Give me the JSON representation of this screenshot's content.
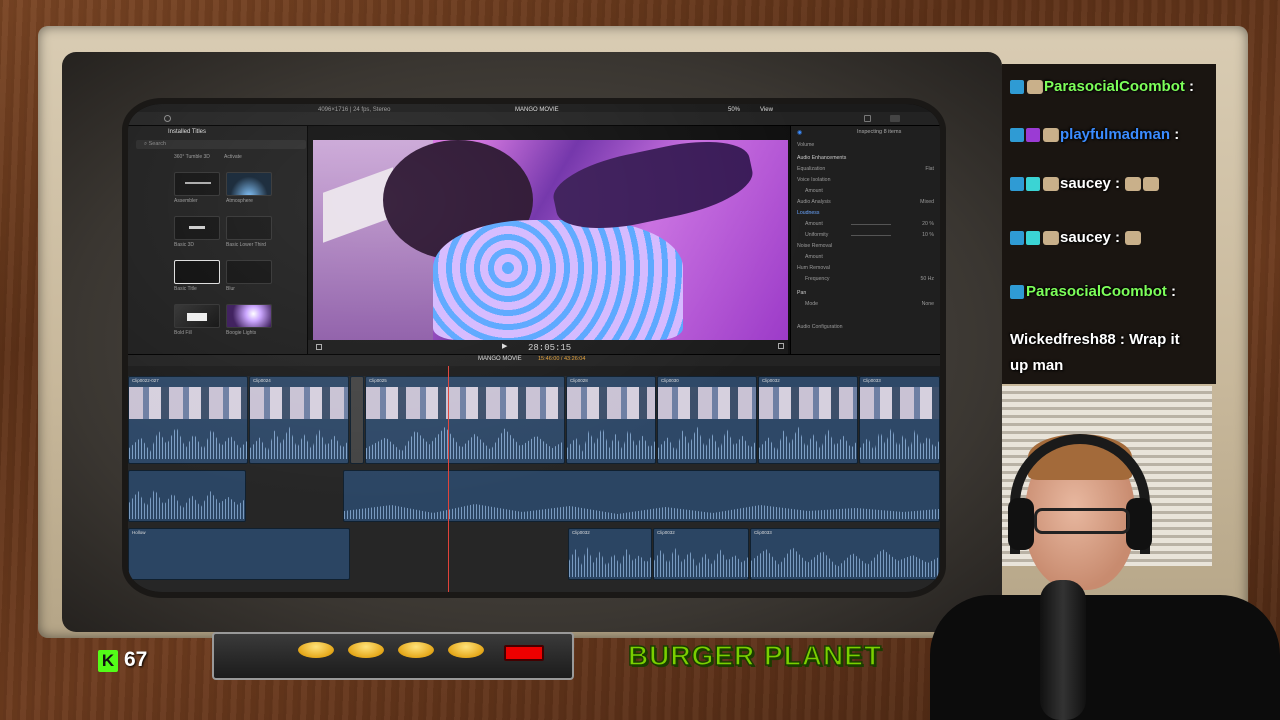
{
  "editor": {
    "browser": {
      "title": "Installed Titles",
      "search_placeholder": "Search",
      "items": [
        {
          "label": "360° Tumble 3D"
        },
        {
          "label": "Activate"
        },
        {
          "label": "Assembler"
        },
        {
          "label": "Atmosphere"
        },
        {
          "label": "Basic 3D"
        },
        {
          "label": "Basic Lower Third"
        },
        {
          "label": "Basic Title"
        },
        {
          "label": "Blur"
        },
        {
          "label": "Bold Fill"
        },
        {
          "label": "Boogie Lights"
        }
      ]
    },
    "viewer": {
      "format": "4096×1716 | 24 fps, Stereo",
      "title": "MANGO MOVIE",
      "zoom": "50%",
      "view": "View",
      "timecode": "28:05:15"
    },
    "inspector": {
      "header": "Inspecting 8 items",
      "rows": [
        {
          "label": "Volume",
          "value": ""
        },
        {
          "label": "Audio Enhancements",
          "value": ""
        },
        {
          "label": "Equalization",
          "value": "Flat"
        },
        {
          "label": "Voice Isolation",
          "value": ""
        },
        {
          "label": "Amount",
          "value": ""
        },
        {
          "label": "Audio Analysis",
          "value": "Mixed"
        },
        {
          "label": "Loudness",
          "value": ""
        },
        {
          "label": "Amount",
          "value": "20 %"
        },
        {
          "label": "Uniformity",
          "value": "10 %"
        },
        {
          "label": "Noise Removal",
          "value": ""
        },
        {
          "label": "Amount",
          "value": ""
        },
        {
          "label": "Hum Removal",
          "value": ""
        },
        {
          "label": "Frequency",
          "value": "50 Hz"
        },
        {
          "label": "Pan",
          "value": ""
        },
        {
          "label": "Mode",
          "value": "None"
        },
        {
          "label": "Audio Configuration",
          "value": ""
        }
      ]
    },
    "timeline": {
      "name": "MANGO MOVIE",
      "duration": "15:46:00 / 43:26:04",
      "video_clips": [
        {
          "label": "Clip0022-027"
        },
        {
          "label": "Clip0024"
        },
        {
          "label": "Clip0025"
        },
        {
          "label": "Clip0028"
        },
        {
          "label": "Clip0030"
        },
        {
          "label": "Clip0032"
        },
        {
          "label": "Clip0033"
        }
      ],
      "audio_clips": [
        {
          "label": "Hollow"
        },
        {
          "label": "Clip0032"
        },
        {
          "label": "Clip0032"
        },
        {
          "label": "Clip0033"
        }
      ]
    }
  },
  "chat": {
    "messages": [
      {
        "user": "ParasocialCoombot",
        "text": ":",
        "color": "#7dff5a"
      },
      {
        "user": "playfulmadman",
        "text": ":",
        "color": "#3b8cff"
      },
      {
        "user": "saucey",
        "text": ":",
        "color": "#ffffff"
      },
      {
        "user": "saucey",
        "text": ":",
        "color": "#ffffff"
      },
      {
        "user": "ParasocialCoombot",
        "text": ":",
        "color": "#7dff5a"
      },
      {
        "user": "Wickedfresh88",
        "text": ": Wrap it",
        "text2": "up man",
        "color": "#ffffff"
      }
    ]
  },
  "overlay": {
    "viewer_count": "67",
    "platform_badge": "K",
    "brand": "BURGER PLANET"
  },
  "colors": {
    "kick_green": "#53fc18",
    "brand_green": "#7ad000",
    "playhead": "#e0433a",
    "alert_red": "#ee0000"
  }
}
